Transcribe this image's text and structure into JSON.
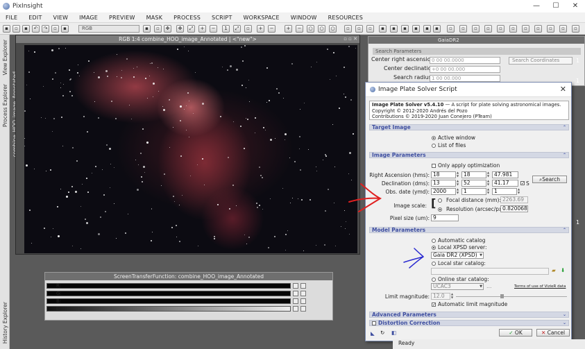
{
  "app": {
    "title": "PixInsight",
    "window_buttons": [
      "—",
      "☐",
      "✕"
    ]
  },
  "menu": [
    "FILE",
    "EDIT",
    "VIEW",
    "IMAGE",
    "PREVIEW",
    "MASK",
    "PROCESS",
    "SCRIPT",
    "WORKSPACE",
    "WINDOW",
    "RESOURCES"
  ],
  "toolbar": {
    "view_select_value": "RGB"
  },
  "left_dock": {
    "tabs": [
      "View Explorer",
      "Process Explorer",
      "combine_HOO_image_Annotated",
      "History Explorer"
    ]
  },
  "image_window": {
    "title": "RGB 1:4 combine_HOO_image_Annotated | <\"new\">"
  },
  "gaia_panel": {
    "title": "GaiaDR2",
    "section": "Search Parameters",
    "ra_label": "Center right ascension:",
    "ra_value": "0 00 00.0000",
    "dec_label": "Center declination:",
    "dec_value": "+0 00 00.000",
    "radius_label": "Search radius:",
    "radius_value": "1 00 00.000",
    "search_btn": "Search Coordinates"
  },
  "right_edge_numbers": [
    "1",
    "1",
    "1"
  ],
  "stf": {
    "title": "ScreenTransferFunction: combine_HOO_image_Annotated",
    "rows": [
      "R:",
      "G:",
      "B:",
      "L:"
    ]
  },
  "dialog": {
    "title": "Image Plate Solver Script",
    "close": "✕",
    "info_line1_bold": "Image Plate Solver v5.4.10",
    "info_line1_rest": " — A script for plate solving astronomical images.",
    "info_line2": "Copyright © 2012-2020 Andrés del Pozo",
    "info_line3": "Contributions © 2019-2020 Juan Conejero (PTeam)",
    "sections": {
      "target": "Target Image",
      "image_params": "Image Parameters",
      "model_params": "Model Parameters",
      "advanced": "Advanced Parameters",
      "distortion": "Distortion Correction"
    },
    "target": {
      "active_window": "Active window",
      "list_of_files": "List of files"
    },
    "image_params": {
      "only_apply": "Only apply optimization",
      "ra_label": "Right Ascension (hms):",
      "ra": [
        "18",
        "18",
        "47.981"
      ],
      "dec_label": "Declination (dms):",
      "dec": [
        "13",
        "52",
        "41.17"
      ],
      "s_label": "S",
      "obs_label": "Obs. date (ymd):",
      "obs": [
        "2000",
        "1",
        "1"
      ],
      "search_btn": "Search",
      "scale_label": "Image scale:",
      "focal_label": "Focal distance (mm):",
      "focal_value": "2263.69",
      "resolution_label": "Resolution (arcsec/px):",
      "resolution_value": "0.820068",
      "pixel_label": "Pixel size (um):",
      "pixel_value": "9"
    },
    "model_params": {
      "auto_catalog": "Automatic catalog",
      "local_xpsd": "Local XPSD server:",
      "xpsd_value": "Gaia DR2 (XPSD)",
      "local_star": "Local star catalog:",
      "online_star": "Online star catalog:",
      "online_value": "UCAC3",
      "terms_link": "Terms of use of VizieR data",
      "limit_label": "Limit magnitude:",
      "limit_value": "12.0",
      "auto_limit": "Automatic limit magnitude"
    },
    "footer": {
      "ok": "OK",
      "cancel": "Cancel"
    }
  },
  "status": {
    "text": "Ready"
  },
  "colors": {
    "section_bg": "#d4d8e4",
    "section_text": "#3f4fa0",
    "red_annotation": "#e02020",
    "blue_annotation": "#2a2ad0"
  }
}
